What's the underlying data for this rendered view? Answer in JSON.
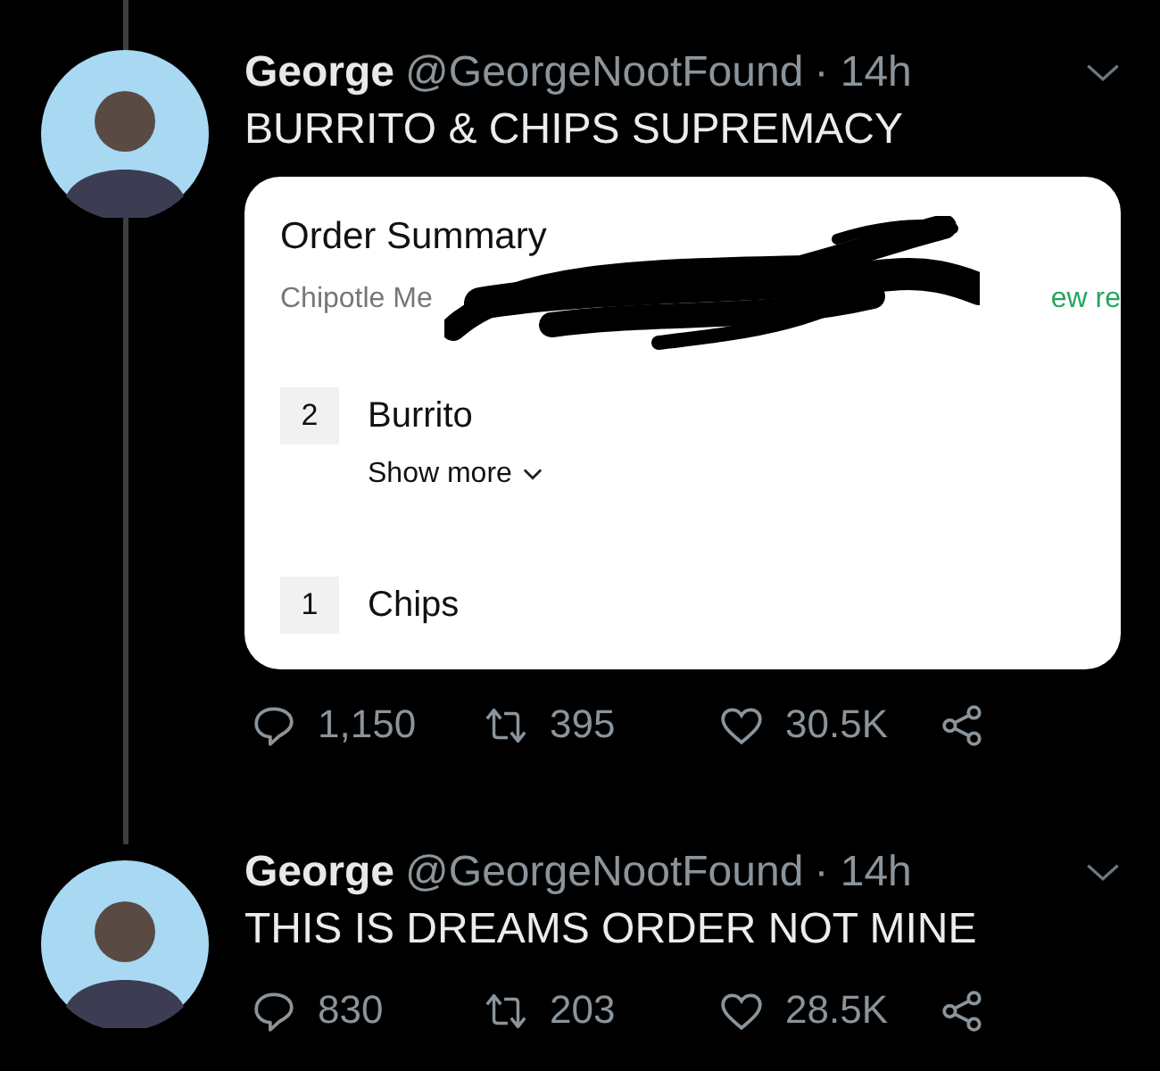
{
  "tweets": [
    {
      "name": "George",
      "handle": "@GeorgeNootFound",
      "time": "· 14h",
      "text": "BURRITO & CHIPS SUPREMACY",
      "thread_line": true,
      "attachment": {
        "title": "Order Summary",
        "restaurant": "Chipotle Me",
        "link": "ew re",
        "items": [
          {
            "qty": "2",
            "name": "Burrito",
            "more": "Show more"
          },
          {
            "qty": "1",
            "name": "Chips"
          }
        ]
      },
      "replies": "1,150",
      "retweets": "395",
      "likes": "30.5K"
    },
    {
      "name": "George",
      "handle": "@GeorgeNootFound",
      "time": "· 14h",
      "text": "THIS IS DREAMS ORDER NOT MINE",
      "thread_line": false,
      "replies": "830",
      "retweets": "203",
      "likes": "28.5K"
    }
  ]
}
